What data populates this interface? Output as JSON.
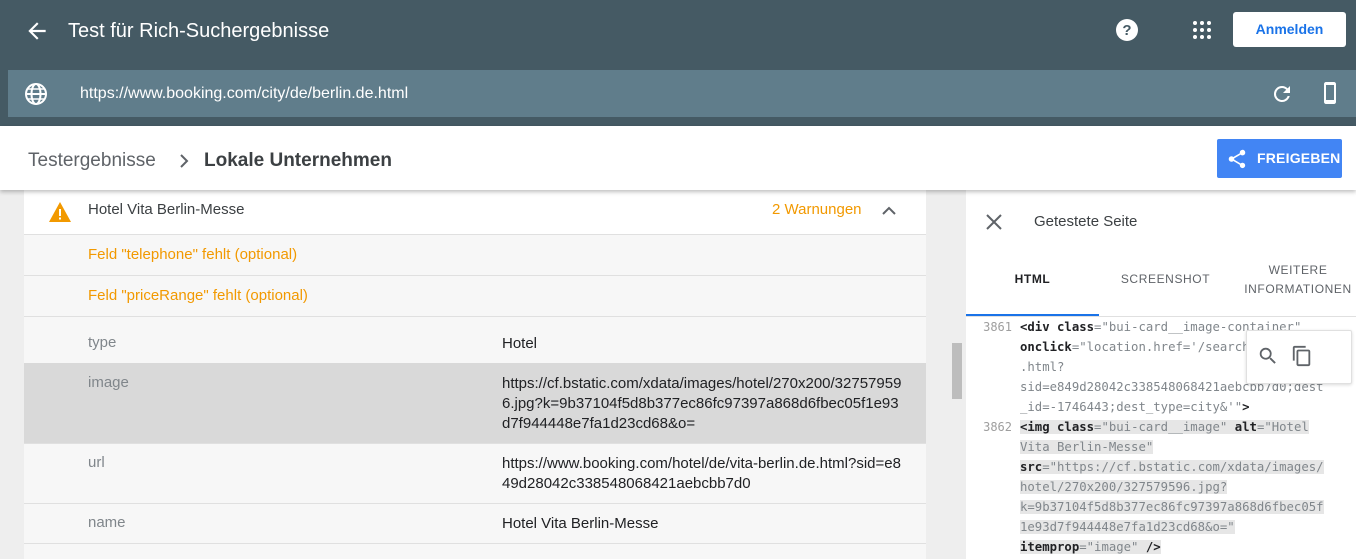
{
  "app": {
    "title": "Test für Rich-Suchergebnisse",
    "login_label": "Anmelden",
    "url": "https://www.booking.com/city/de/berlin.de.html",
    "icons": [
      "back-arrow-icon",
      "help-icon",
      "apps-grid-icon",
      "globe-icon",
      "reload-icon",
      "smartphone-icon"
    ]
  },
  "breadcrumb": {
    "root": "Testergebnisse",
    "current": "Lokale Unternehmen"
  },
  "share_label": "FREIGEBEN",
  "item": {
    "name": "Hotel Vita Berlin-Messe",
    "warnings_label": "2 Warnungen",
    "warnings": [
      "Feld \"telephone\" fehlt (optional)",
      "Feld \"priceRange\" fehlt (optional)"
    ],
    "properties": [
      {
        "name": "type",
        "value": "Hotel"
      },
      {
        "name": "image",
        "value": "https://cf.bstatic.com/xdata/images/hotel/270x200/327579596.jpg?k=9b37104f5d8b377ec86fc97397a868d6fbec05f1e93d7f944448e7fa1d23cd68&o="
      },
      {
        "name": "url",
        "value": "https://www.booking.com/hotel/de/vita-berlin.de.html?sid=e849d28042c338548068421aebcbb7d0"
      },
      {
        "name": "name",
        "value": "Hotel Vita Berlin-Messe"
      }
    ]
  },
  "panel": {
    "title": "Getestete Seite",
    "tabs": [
      {
        "label": "HTML"
      },
      {
        "label": "SCREENSHOT"
      },
      {
        "label_line1": "WEITERE",
        "label_line2": "INFORMATIONEN"
      }
    ],
    "code": {
      "line_numbers": [
        "3861",
        "3862"
      ],
      "lines": [
        {
          "tag": "<div",
          "attr1": " class",
          "eq1": "=",
          "val1": "\"bui-card__image-container\""
        },
        {
          "attr": "onclick",
          "eq": "=",
          "val": "\"location.href='/search"
        },
        {
          "text": ".html?"
        },
        {
          "text": "sid=e849d28042c338548068421aebcbb7d0;dest"
        },
        {
          "text": "_id=-1746443;dest_type=city&'\"",
          "close": ">"
        },
        {
          "tag": "<img",
          "attr1": " class",
          "eq1": "=",
          "val1": "\"bui-card__image\"",
          "attr2": " alt",
          "eq2": "=",
          "val2": "\"Hotel"
        },
        {
          "text": "Vita Berlin-Messe\""
        },
        {
          "attr": "src",
          "eq": "=",
          "val": "\"https://cf.bstatic.com/xdata/images/"
        },
        {
          "text": "hotel/270x200/327579596.jpg?"
        },
        {
          "text": "k=9b37104f5d8b377ec86fc97397a868d6fbec05f"
        },
        {
          "text": "1e93d7f944448e7fa1d23cd68&o=\""
        },
        {
          "attr": "itemprop",
          "eq": "=",
          "val": "\"image\"",
          "close": " />"
        }
      ]
    }
  }
}
